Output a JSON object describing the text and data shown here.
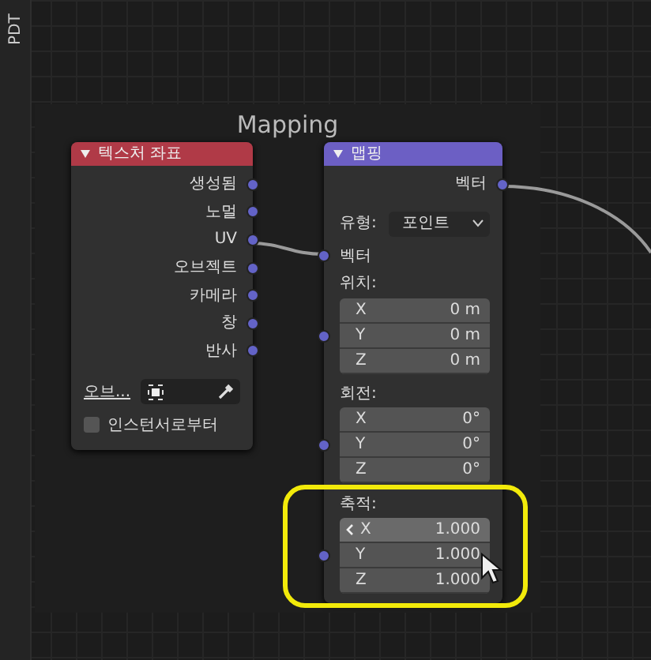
{
  "sidebar_tab": {
    "label": "PDT"
  },
  "frame": {
    "title": "Mapping"
  },
  "nodes": [
    {
      "title": "텍스처 좌표",
      "color": "#b03a47",
      "outputs": [
        "생성됨",
        "노멀",
        "UV",
        "오브젝트",
        "카메라",
        "창",
        "반사"
      ],
      "object_field": {
        "label": "오브..."
      },
      "checkbox": {
        "label": "인스턴서로부터",
        "checked": false
      }
    },
    {
      "title": "맵핑",
      "color": "#6c5fc4",
      "outputs": [
        "벡터"
      ],
      "type_dropdown": {
        "label": "유형:",
        "value": "포인트"
      },
      "inputs": [
        "벡터"
      ],
      "groups": [
        {
          "label": "위치:",
          "fields": [
            {
              "axis": "X",
              "value": "0 m",
              "hovered": false
            },
            {
              "axis": "Y",
              "value": "0 m",
              "hovered": false
            },
            {
              "axis": "Z",
              "value": "0 m",
              "hovered": false
            }
          ]
        },
        {
          "label": "회전:",
          "fields": [
            {
              "axis": "X",
              "value": "0°",
              "hovered": false
            },
            {
              "axis": "Y",
              "value": "0°",
              "hovered": false
            },
            {
              "axis": "Z",
              "value": "0°",
              "hovered": false
            }
          ]
        },
        {
          "label": "축적:",
          "highlighted": true,
          "fields": [
            {
              "axis": "X",
              "value": "1.000",
              "hovered": true
            },
            {
              "axis": "Y",
              "value": "1.000",
              "hovered": false
            },
            {
              "axis": "Z",
              "value": "1.000",
              "hovered": false
            }
          ]
        }
      ]
    }
  ]
}
